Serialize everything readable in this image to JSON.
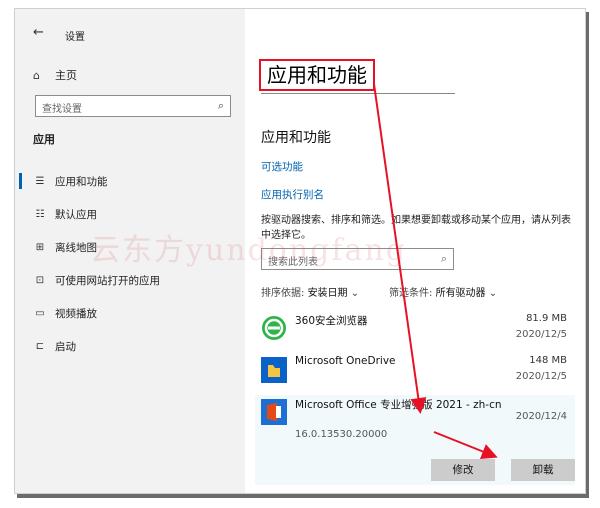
{
  "window": {
    "back_glyph": "←",
    "title": "设置"
  },
  "sidebar": {
    "home_label": "主页",
    "search_placeholder": "查找设置",
    "section_label": "应用",
    "items": [
      {
        "label": "应用和功能",
        "icon": "apps-features-icon",
        "active": true
      },
      {
        "label": "默认应用",
        "icon": "default-apps-icon"
      },
      {
        "label": "离线地图",
        "icon": "offline-maps-icon"
      },
      {
        "label": "可使用网站打开的应用",
        "icon": "apps-for-websites-icon"
      },
      {
        "label": "视频播放",
        "icon": "video-playback-icon"
      },
      {
        "label": "启动",
        "icon": "startup-icon"
      }
    ]
  },
  "main": {
    "page_title": "应用和功能",
    "section_title": "应用和功能",
    "link_optional": "可选功能",
    "link_alias": "应用执行别名",
    "description": "按驱动器搜索、排序和筛选。如果想要卸载或移动某个应用，请从列表中选择它。",
    "list_search_placeholder": "搜索此列表",
    "sort_label": "排序依据:",
    "sort_value": "安装日期",
    "filter_label": "筛选条件:",
    "filter_value": "所有驱动器",
    "apps": [
      {
        "name": "360安全浏览器",
        "size": "81.9 MB",
        "date": "2020/12/5",
        "icon": "360-browser-icon"
      },
      {
        "name": "Microsoft OneDrive",
        "size": "148 MB",
        "date": "2020/12/5",
        "icon": "onedrive-icon"
      },
      {
        "name": "Microsoft Office 专业增强版 2021 - zh-cn",
        "size": "",
        "date": "2020/12/4",
        "version": "16.0.13530.20000",
        "icon": "office-icon",
        "selected": true
      }
    ],
    "modify_button": "修改",
    "uninstall_button": "卸载"
  },
  "annotations": {
    "highlight_color": "#e81123",
    "accent_color": "#0063b1"
  }
}
